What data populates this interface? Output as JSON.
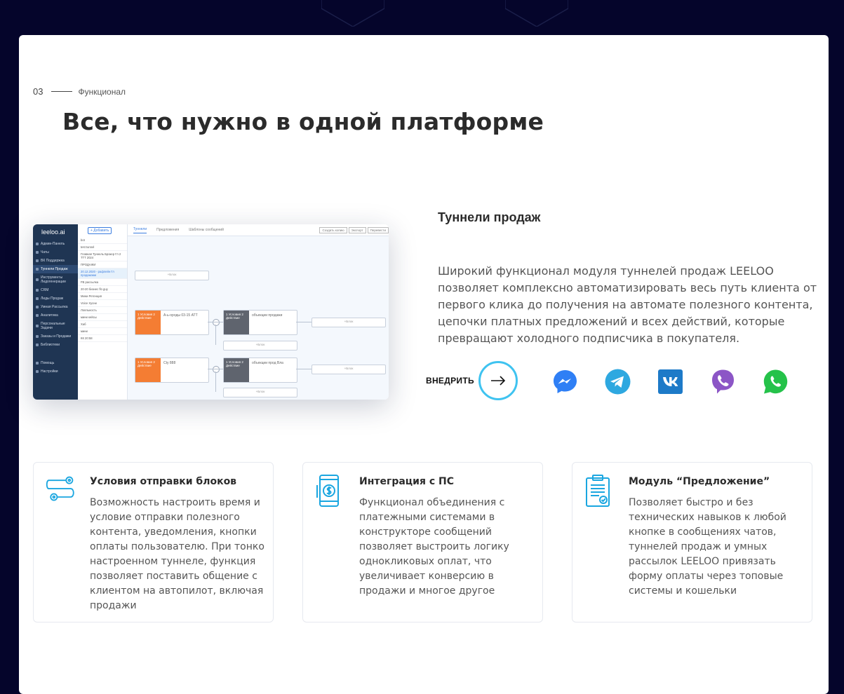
{
  "section": {
    "number": "03",
    "label": "Функционал"
  },
  "page_title": "Все, что нужно в одной платформе",
  "screenshot_mock": {
    "logo": "leeloo.ai",
    "sidebar": [
      "Админ-Панель",
      "Чаты",
      "ВК Поддержка",
      "Туннели Продаж",
      "Инструменты Лидогенерации",
      "CRM",
      "Лиды Продаж",
      "Умная Рассылка",
      "Аналитика",
      "Персональные Задачи",
      "Заказы и Продажи",
      "Библиотеки",
      "Помощь",
      "Настройки"
    ],
    "add_button": "+ Добавить",
    "tabs": [
      "Туннели",
      "Предложения",
      "Шаблоны сообщений"
    ],
    "top_buttons": [
      "Создать копию",
      "Экспорт",
      "Перевести"
    ],
    "list_items": [
      "bot",
      "test tunnel",
      "Главная Туннель Брокер Гл 2 TTT 2024",
      "ПРОДАЖИ",
      "20.12.2020 - рафлейн Гл продажами",
      "FB рассылка",
      "20-20 бизнес flo guy",
      "Мини Ретенция",
      "Voice Хусни",
      "Лояльность",
      "мини кейсы",
      "Хаб",
      "мини",
      "КК 20:58"
    ],
    "nodes": [
      "+Блок",
      "А-ь-ороды 03-15 ATT",
      "объекции продажи",
      "1 Условия 2 Действие",
      "Cty 888",
      "объекции прод Вла"
    ]
  },
  "feature": {
    "title": "Туннели продаж",
    "description": "Широкий функционал модуля туннелей продаж LEELOO позволяет комплексно автоматизировать весь путь клиента от первого клика до получения на автомате полезного контента, цепочки платных предложений и всех действий, которые превращают холодного подписчика в покупателя.",
    "cta": "ВНЕДРИТЬ"
  },
  "messengers": [
    "messenger-icon",
    "telegram-icon",
    "vk-icon",
    "viber-icon",
    "whatsapp-icon"
  ],
  "cards": [
    {
      "title": "Условия отправки блоков",
      "text": "Возможность настроить время и условие отправки полезного контента, уведомления, кнопки оплаты пользователю. При тонко настроенном туннеле, функция позволяет поставить общение с клиентом на автопилот, включая продажи"
    },
    {
      "title": "Интеграция с ПС",
      "text": "Функционал объединения с платежными системами в конструкторе сообщений позволяет выстроить логику однокликовых оплат, что увеличивает конверсию в продажи и многое другое"
    },
    {
      "title": "Модуль “Предложение”",
      "text": "Позволяет быстро и без технических навыков к любой кнопке в сообщениях чатов, туннелей продаж и умных рассылок LEELOO привязать форму оплаты через топовые системы и кошельки"
    }
  ],
  "colors": {
    "background": "#05052b",
    "accent": "#3fc3f0",
    "orange": "#f47d33",
    "sidebar": "#1f3553"
  }
}
